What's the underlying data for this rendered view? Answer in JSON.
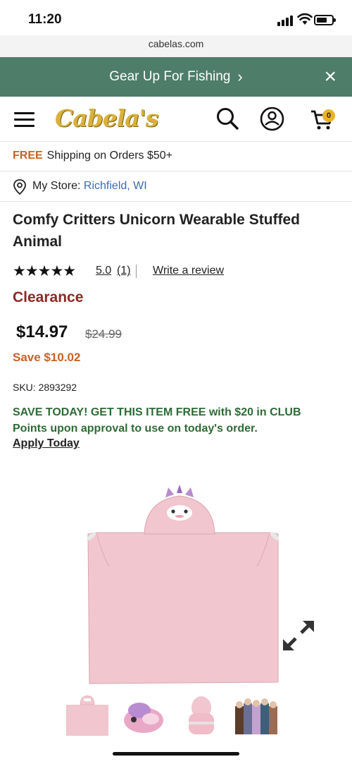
{
  "status_bar": {
    "time": "11:20"
  },
  "browser": {
    "url": "cabelas.com"
  },
  "promo": {
    "text": "Gear Up For Fishing"
  },
  "header": {
    "logo_text": "Cabela's",
    "cart_count": "0"
  },
  "shipping": {
    "free_label": "FREE",
    "text": "Shipping on Orders $50+"
  },
  "store": {
    "label": "My Store:",
    "city": "Richfield, WI"
  },
  "product": {
    "title": "Comfy Critters Unicorn Wearable Stuffed Animal",
    "stars": "★★★★★",
    "rating": "5.0",
    "review_count": "(1)",
    "write_review": "Write a review",
    "badge": "Clearance",
    "price": "$14.97",
    "was_price": "$24.99",
    "savings": "Save $10.02",
    "sku": "SKU: 2893292",
    "club_offer": "SAVE TODAY! GET THIS ITEM FREE with $20 in CLUB Points upon approval to use on today's order.",
    "apply_link": "Apply Today"
  },
  "gallery": {
    "icons": [
      "expand-icon"
    ],
    "thumbnails": [
      "blanket",
      "plush",
      "rolled",
      "kids"
    ],
    "selected_index": 0
  },
  "colors": {
    "promo_bg": "#4e7d6a",
    "accent_orange": "#c96125",
    "clearance_red": "#8a2a26",
    "club_green": "#2e6a36",
    "link_blue": "#3c6bb5",
    "blanket_pink": "#f1c6cf"
  }
}
